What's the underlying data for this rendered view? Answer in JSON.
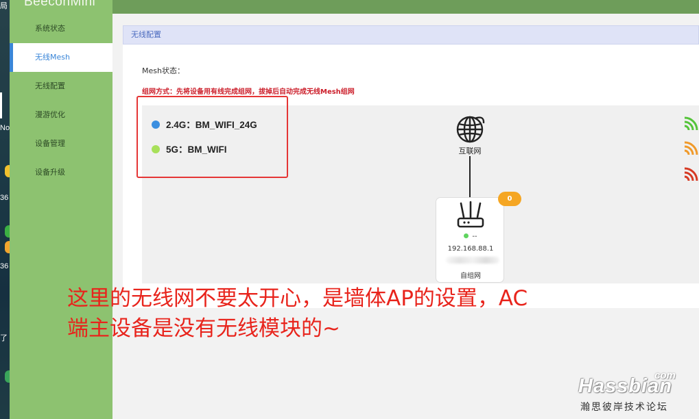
{
  "app": {
    "logo": "BeeconMini"
  },
  "desktop_fragments": {
    "top": "局",
    "n": "No",
    "n1": "36",
    "n2": "36",
    "n3": "了"
  },
  "sidebar": {
    "items": [
      {
        "label": "系统状态",
        "active": false
      },
      {
        "label": "无线Mesh",
        "active": true
      },
      {
        "label": "无线配置",
        "active": false
      },
      {
        "label": "漫游优化",
        "active": false
      },
      {
        "label": "设备管理",
        "active": false
      },
      {
        "label": "设备升级",
        "active": false
      }
    ]
  },
  "panel": {
    "title": "无线配置",
    "mesh_status_label": "Mesh状态：",
    "mesh_note": "组网方式：先将设备用有线完成组网，拔掉后自动完成无线Mesh组网"
  },
  "ssids": [
    {
      "label": "2.4G：BM_WIFI_24G",
      "color": "#3b8fe0"
    },
    {
      "label": "5G：BM_WIFI",
      "color": "#a8e05a"
    }
  ],
  "topology": {
    "internet_label": "互联网",
    "badge_count": "0",
    "node": {
      "status_text": "--",
      "ip": "192.168.88.1",
      "type": "自组网"
    }
  },
  "signal_legend": [
    "#55c43a",
    "#f09a2a",
    "#d63a24"
  ],
  "annotation": {
    "line1": "这里的无线网不要太开心，是墙体AP的设置，AC",
    "line2": "端主设备是没有无线模块的~"
  },
  "watermark": {
    "com": "com",
    "main": "Hassbian",
    "sub": "瀚思彼岸技术论坛"
  },
  "colors": {
    "sidebar": "#8dc270",
    "accent": "#3a86d8",
    "header": "#6e9d5a",
    "annotation": "#e8241c"
  }
}
